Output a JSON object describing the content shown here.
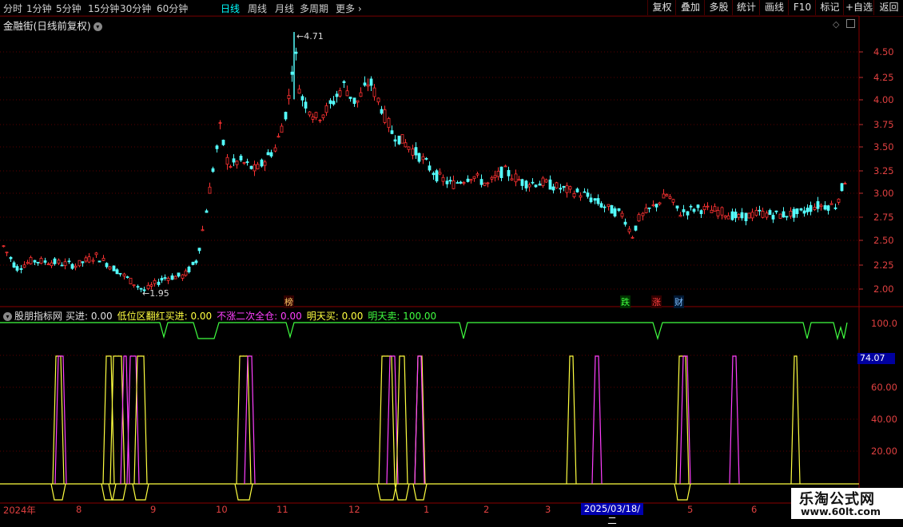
{
  "toolbar": {
    "periods": [
      "分时",
      "1分钟",
      "5分钟",
      "15分钟",
      "30分钟",
      "60分钟",
      "日线",
      "周线",
      "月线",
      "多周期",
      "更多"
    ],
    "active_period": "日线",
    "buttons": [
      "复权",
      "叠加",
      "多股",
      "统计",
      "画线",
      "F10",
      "标记",
      "+自选",
      "返回"
    ]
  },
  "chart_title": "金融街(日线前复权)",
  "price_axis": [
    "4.50",
    "4.25",
    "4.00",
    "3.75",
    "3.50",
    "3.25",
    "3.00",
    "2.75",
    "2.50",
    "2.25",
    "2.00"
  ],
  "max_label": "4.71",
  "min_label": "1.95",
  "event_marks": [
    {
      "text": "榜",
      "color": "#ffcc66",
      "bg": "#300000"
    },
    {
      "text": "跌",
      "color": "#40ff40",
      "bg": "#003300"
    },
    {
      "text": "涨",
      "color": "#ff4040",
      "bg": "#330000"
    },
    {
      "text": "财",
      "color": "#80c0ff",
      "bg": "#001833"
    }
  ],
  "indicator": {
    "name": "股朋指标网",
    "fields": [
      {
        "label": "买进:",
        "value": "0.00",
        "color": "#e0e0e0"
      },
      {
        "label": "低位区翻红买进:",
        "value": "0.00",
        "color": "#ffff40"
      },
      {
        "label": "不涨二次全仓:",
        "value": "0.00",
        "color": "#ff40ff"
      },
      {
        "label": "明天买:",
        "value": "0.00",
        "color": "#ffff40"
      },
      {
        "label": "明天卖:",
        "value": "100.00",
        "color": "#40ff40"
      }
    ],
    "axis": [
      "100.0",
      "60.00",
      "40.00",
      "20.00"
    ],
    "current": "74.07"
  },
  "date_axis": [
    "2024年",
    "8",
    "9",
    "10",
    "11",
    "12",
    "1",
    "2",
    "3",
    "4",
    "5",
    "6"
  ],
  "date_cursor": "2025/03/18/二",
  "watermark": {
    "line1": "乐淘公式网",
    "line2": "www.60lt.com"
  },
  "colors": {
    "up": "#ff3232",
    "down": "#54ffff",
    "grid": "#5a0000",
    "yellow": "#ffff40",
    "magenta": "#ff40ff",
    "green": "#40ff40"
  }
}
